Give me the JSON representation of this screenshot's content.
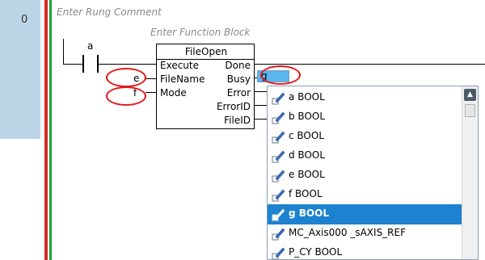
{
  "rung": {
    "number": "0",
    "comment_placeholder": "Enter Rung Comment",
    "fb_comment_placeholder": "Enter Function Block"
  },
  "contact": {
    "variable": "a"
  },
  "function_block": {
    "name": "FileOpen",
    "inputs": [
      "Execute",
      "FileName",
      "Mode"
    ],
    "outputs": [
      "Done",
      "Busy",
      "Error",
      "ErrorID",
      "FileID"
    ],
    "input_vars": {
      "filename": "e",
      "mode": "f"
    }
  },
  "busy_input": {
    "value": "g"
  },
  "autocomplete": {
    "items": [
      {
        "label": "a BOOL",
        "selected": false
      },
      {
        "label": "b BOOL",
        "selected": false
      },
      {
        "label": "c BOOL",
        "selected": false
      },
      {
        "label": "d BOOL",
        "selected": false
      },
      {
        "label": "e BOOL",
        "selected": false
      },
      {
        "label": "f BOOL",
        "selected": false
      },
      {
        "label": "g BOOL",
        "selected": true
      },
      {
        "label": "MC_Axis000 _sAXIS_REF",
        "selected": false
      },
      {
        "label": "P_CY BOOL",
        "selected": false
      }
    ],
    "scroll_up_icon": "triangle-up"
  },
  "colors": {
    "rung_number_bg": "#bcd5e6",
    "left_rail_red": "#d42a25",
    "left_rail_green": "#279a3b",
    "highlight_ellipse": "#e11b1b",
    "selected_item_bg": "#1d82cf",
    "edit_box_bg": "#59b6ee"
  }
}
